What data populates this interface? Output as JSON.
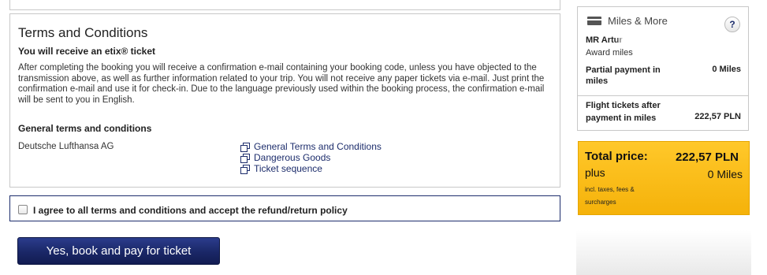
{
  "terms": {
    "title": "Terms and Conditions",
    "subtitle": "You will receive an etix® ticket",
    "body": "After completing the booking you will receive a confirmation e-mail containing your booking code, unless you have objected to the transmission above, as well as further information related to your trip. You will not receive any paper tickets via e-mail. Just print the confirmation e-mail and use it for check-in. Due to the language previously used within the booking process, the confirmation e-mail will be sent to you in English.",
    "gtc_heading": "General terms and conditions",
    "company": "Deutsche Lufthansa AG",
    "links": [
      "General Terms and Conditions",
      "Dangerous Goods",
      "Ticket sequence"
    ]
  },
  "agreement": {
    "label": "I agree to all terms and conditions and accept the refund/return policy",
    "checked": false
  },
  "book_button": {
    "label": "Yes, book and pay for ticket"
  },
  "sidebar": {
    "title": "Miles & More",
    "help_label": "?",
    "name": "MR Artur",
    "award_label": "Award miles",
    "partial_label": "Partial payment in miles",
    "partial_value": "0 Miles",
    "flight_label": "Flight tickets after payment in miles",
    "flight_value": "222,57 PLN"
  },
  "total": {
    "label": "Total price:",
    "value": "222,57 PLN",
    "plus_label": "plus",
    "miles_value": "0 Miles",
    "incl_label": "incl. taxes, fees & surcharges"
  },
  "colors": {
    "navy": "#1d2d6c",
    "total_bg": "#ffc82a",
    "border": "#c8c8c8"
  }
}
